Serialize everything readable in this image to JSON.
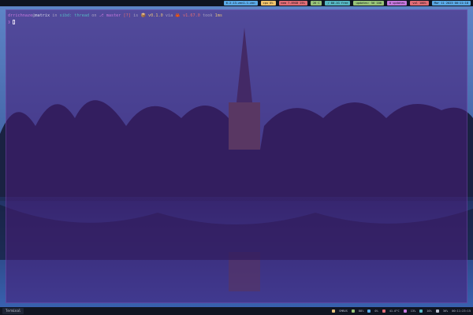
{
  "statusbar": {
    "modules": [
      {
        "label": "6.2.13-zen1-1-zen",
        "color": "#5aa9e6"
      },
      {
        "label": "cpu 0%",
        "color": "#f0c36b"
      },
      {
        "label": "mem 7.89GB 25%",
        "color": "#e06c75"
      },
      {
        "label": "26 C",
        "color": "#98c379"
      },
      {
        "label": "/ 80.1G free",
        "color": "#56b6c2"
      },
      {
        "label": "updates: 56 100",
        "color": "#98c379"
      },
      {
        "label": "0 updates",
        "color": "#c678dd"
      },
      {
        "label": "vol 100%",
        "color": "#e06c75"
      },
      {
        "label": "Mar 11 2023 00:11:18",
        "color": "#5aa9e6"
      }
    ]
  },
  "terminal": {
    "user": "drrichnaze",
    "at": "@",
    "host": "matrix",
    "in": " in ",
    "dir": "sibd: thread",
    "on": " on ",
    "branch": "⎇ master",
    "status": " [?] ",
    "is": "is ",
    "pkg": "📦 v0.1.0",
    "via": " via ",
    "rust": "🦀 v1.67.0",
    "took": " took ",
    "duration": "1ms",
    "prompt_symbol": "❯ "
  },
  "taskbar": {
    "task_label": "Terminal",
    "tray": {
      "brightness": "SMBUS",
      "battery": "88%",
      "cpu": "0%",
      "temp": "41.0°C",
      "mem": "13%",
      "net": "10%",
      "volume": "36%",
      "clock": "00:11:23:15"
    }
  }
}
